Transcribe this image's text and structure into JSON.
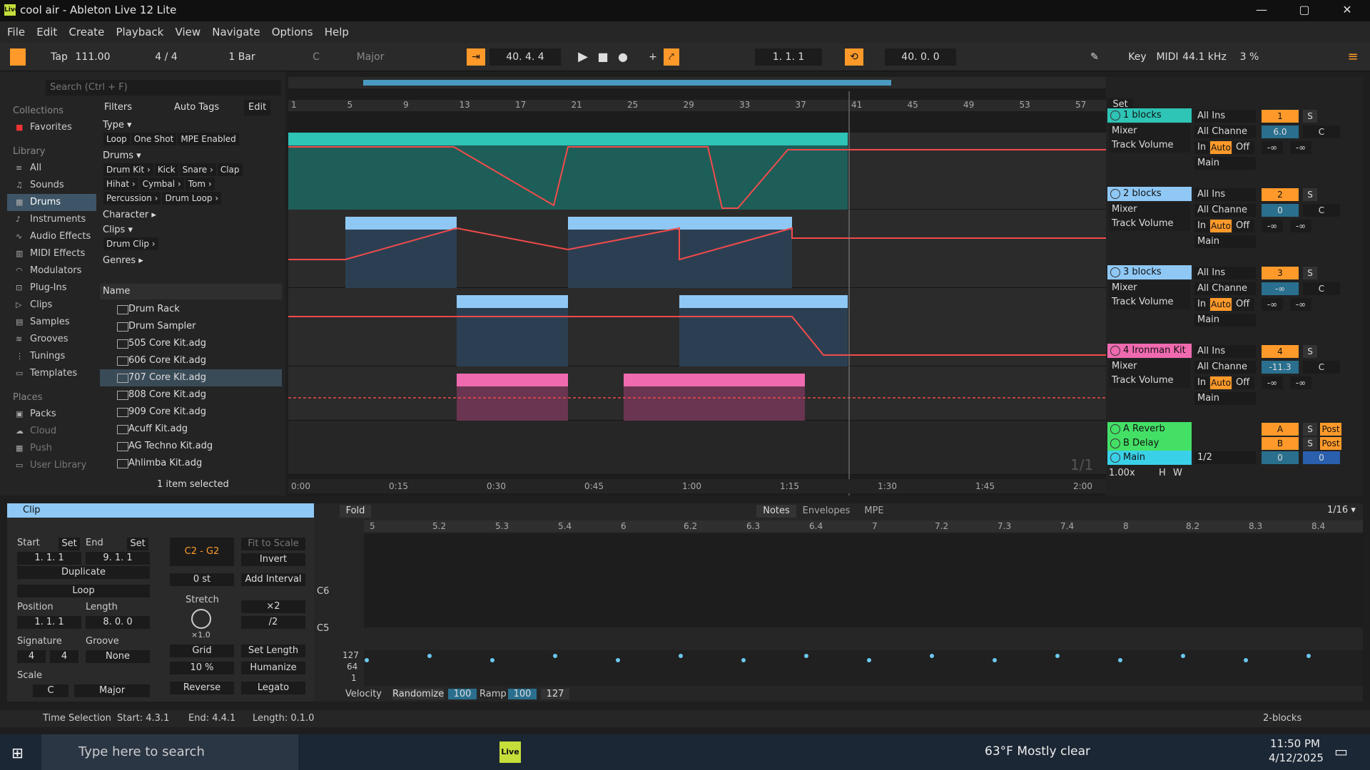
{
  "window": {
    "title": "cool air - Ableton Live 12 Lite",
    "min": "—",
    "max": "▢",
    "close": "✕"
  },
  "menu": [
    "File",
    "Edit",
    "Create",
    "Playback",
    "View",
    "Navigate",
    "Options",
    "Help"
  ],
  "transport": {
    "tap": "Tap",
    "tempo": "111.00",
    "sig": "4 / 4",
    "quant": "1 Bar",
    "key": "C",
    "scale": "Major",
    "pos": "40.   4.   4",
    "loop_start": "1.   1.   1",
    "loop_len": "40.   0.   0",
    "key_btn": "Key",
    "midi": "MIDI",
    "rate": "44.1 kHz",
    "cpu": "3 %"
  },
  "browser": {
    "search": "Search (Ctrl + F)",
    "collections_h": "Collections",
    "favorites": "Favorites",
    "library_h": "Library",
    "library": [
      "All",
      "Sounds",
      "Drums",
      "Instruments",
      "Audio Effects",
      "MIDI Effects",
      "Modulators",
      "Plug-Ins",
      "Clips",
      "Samples",
      "Grooves",
      "Tunings",
      "Templates"
    ],
    "places_h": "Places",
    "places": [
      "Packs",
      "Cloud",
      "Push",
      "User Library"
    ],
    "filters": "Filters",
    "auto_tags": "Auto Tags",
    "edit": "Edit",
    "type_h": "Type ▾",
    "type_tags": [
      "Loop",
      "One Shot",
      "MPE Enabled"
    ],
    "drums_h": "Drums ▾",
    "drum_tags": [
      "Drum Kit ›",
      "Kick",
      "Snare ›",
      "Clap",
      "Hihat ›",
      "Cymbal ›",
      "Tom ›",
      "Percussion ›",
      "Drum Loop ›"
    ],
    "character": "Character ▸",
    "clips_h": "Clips ▾",
    "clip_tags": [
      "Drum Clip ›"
    ],
    "genres": "Genres ▸",
    "name_h": "Name",
    "files": [
      "Drum Rack",
      "Drum Sampler",
      "505 Core Kit.adg",
      "606 Core Kit.adg",
      "707 Core Kit.adg",
      "808 Core Kit.adg",
      "909 Core Kit.adg",
      "Acuff Kit.adg",
      "AG Techno Kit.adg",
      "Ahlimba Kit.adg"
    ],
    "status": "1 item selected"
  },
  "ruler": [
    "1",
    "5",
    "9",
    "13",
    "17",
    "21",
    "25",
    "29",
    "33",
    "37",
    "41",
    "45",
    "49",
    "53",
    "57"
  ],
  "timeline": [
    "0:00",
    "0:15",
    "0:30",
    "0:45",
    "1:00",
    "1:15",
    "1:30",
    "1:45",
    "2:00"
  ],
  "set_btn": "Set",
  "page_count": "1/1",
  "tracks": [
    {
      "name": "1 blocks",
      "num": "1",
      "vol": "6.0",
      "pan": "C",
      "color": "#2ec4b6"
    },
    {
      "name": "2 blocks",
      "num": "2",
      "vol": "0",
      "pan": "C",
      "color": "#8fc8f5"
    },
    {
      "name": "3 blocks",
      "num": "3",
      "vol": "-∞",
      "pan": "C",
      "color": "#8fc8f5"
    },
    {
      "name": "4 Ironman Kit",
      "num": "4",
      "vol": "-11.3",
      "pan": "C",
      "color": "#f06ab0"
    }
  ],
  "io": {
    "all_ins": "All Ins",
    "all_chan": "All Channe",
    "mixer": "Mixer",
    "trackvol": "Track Volume",
    "in": "In",
    "auto": "Auto",
    "off": "Off",
    "main": "Main",
    "minf": "-∞",
    "s": "S"
  },
  "returns": [
    {
      "name": "A Reverb",
      "letter": "A",
      "post": "Post"
    },
    {
      "name": "B Delay",
      "letter": "B",
      "post": "Post"
    }
  ],
  "master": {
    "name": "Main",
    "route": "1/2",
    "vol": "0",
    "pan": "0"
  },
  "zoom": "1.00x",
  "h": "H",
  "w": "W",
  "clipview": {
    "title": "Clip",
    "start": "Start",
    "end": "End",
    "set": "Set",
    "start_v": "1.   1.   1",
    "end_v": "9.   1.   1",
    "duplicate": "Duplicate",
    "loop": "Loop",
    "position": "Position",
    "length": "Length",
    "pos_v": "1.   1.   1",
    "len_v": "8.   0.   0",
    "signature": "Signature",
    "groove": "Groove",
    "sig_n": "4",
    "sig_d": "4",
    "groove_v": "None",
    "scale": "Scale",
    "scale_key": "C",
    "scale_mode": "Major",
    "range": "C2 - G2",
    "fit": "Fit to Scale",
    "invert": "Invert",
    "st": "0 st",
    "add_int": "Add Interval",
    "stretch": "Stretch",
    "x2": "×2",
    "d2": "/2",
    "x1": "×1.0",
    "grid": "Grid",
    "set_len": "Set Length",
    "pct": "10 %",
    "humanize": "Humanize",
    "reverse": "Reverse",
    "legato": "Legato"
  },
  "noteview": {
    "fold": "Fold",
    "tabs": [
      "Notes",
      "Envelopes",
      "MPE"
    ],
    "grid": "1/16 ▾",
    "ruler": [
      "5",
      "5.2",
      "5.3",
      "5.4",
      "6",
      "6.2",
      "6.3",
      "6.4",
      "7",
      "7.2",
      "7.3",
      "7.4",
      "8",
      "8.2",
      "8.3",
      "8.4"
    ],
    "c6": "C6",
    "c5": "C5",
    "v127": "127",
    "v64": "64",
    "v1": "1",
    "velocity": "Velocity",
    "randomize": "Randomize",
    "r_val": "100",
    "ramp": "Ramp",
    "ramp_val": "100",
    "ramp_max": "127"
  },
  "status": {
    "label": "Time Selection",
    "start": "Start: 4.3.1",
    "end": "End: 4.4.1",
    "length": "Length: 0.1.0",
    "right": "2-blocks"
  },
  "taskbar": {
    "search": "Type here to search",
    "weather": "63°F  Mostly clear",
    "time": "11:50 PM",
    "date": "4/12/2025",
    "app_live": "Live"
  }
}
